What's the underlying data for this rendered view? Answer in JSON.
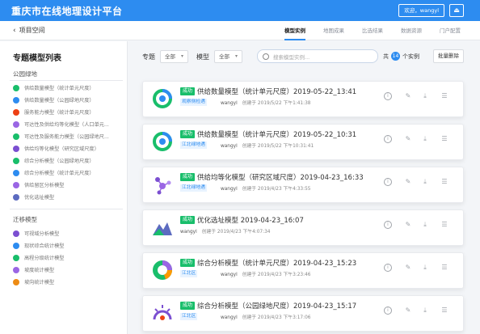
{
  "header": {
    "app_title": "重庆市在线地理设计平台",
    "welcome": "欢迎，wangyl",
    "logout_icon": "logout-icon"
  },
  "subnav": {
    "back_label": "项目空间",
    "tabs": [
      {
        "label": "模型实例",
        "active": true
      },
      {
        "label": "地图成果",
        "active": false
      },
      {
        "label": "比选结果",
        "active": false
      },
      {
        "label": "数据资源",
        "active": false
      },
      {
        "label": "门户配置",
        "active": false
      }
    ]
  },
  "sidebar": {
    "title": "专题模型列表",
    "group1": {
      "label": "公园绿地",
      "items": [
        {
          "label": "供给数量模型（统计单元尺度）",
          "color": "#19be6b"
        },
        {
          "label": "供给数量模型（公园绿地尺度）",
          "color": "#2d8cf0"
        },
        {
          "label": "服务能力模型（统计单元尺度）",
          "color": "#ed4014"
        },
        {
          "label": "可达性及供给均等化模型（人口单元...",
          "color": "#9a66e4"
        },
        {
          "label": "可达性及服务能力模型（公园绿地尺...",
          "color": "#19be6b"
        },
        {
          "label": "供给均等化模型（研究区域尺度）",
          "color": "#7b4fd1"
        },
        {
          "label": "综合分析模型（公园绿地尺度）",
          "color": "#19be6b"
        },
        {
          "label": "综合分析模型（统计单元尺度）",
          "color": "#2d8cf0"
        },
        {
          "label": "供给留区分析模型",
          "color": "#9a66e4"
        },
        {
          "label": "优化选址模型",
          "color": "#5c6bc0"
        }
      ]
    },
    "group2": {
      "label": "迁移模型",
      "items": [
        {
          "label": "可视域分析模型",
          "color": "#7b4fd1"
        },
        {
          "label": "现状综合统计模型",
          "color": "#2d8cf0"
        },
        {
          "label": "高程分级统计模型",
          "color": "#19be6b"
        },
        {
          "label": "坡度统计模型",
          "color": "#9a66e4"
        },
        {
          "label": "坡向统计模型",
          "color": "#ed8b14"
        }
      ]
    }
  },
  "filter": {
    "topic_label": "专题",
    "topic_value": "全部",
    "model_label": "模型",
    "model_value": "全部",
    "search_placeholder": "搜索模型实例...",
    "count_prefix": "共",
    "count_num": "14",
    "count_suffix": "个实例",
    "batch_delete": "批量删除"
  },
  "cards": [
    {
      "status": "成功",
      "title": "供给数量模型（统计单元尺度）2019-05-22_13:41",
      "tag": "观察侧检遇",
      "user": "wangyl",
      "created": "创建于 2019/5/22 下午1:41:38",
      "icon": "ring-chart-icon"
    },
    {
      "status": "成功",
      "title": "供给数量模型（统计单元尺度）2019-05-22_10:31",
      "tag": "江北绿地遇",
      "user": "wangyl",
      "created": "创建于 2019/5/22 下午10:31:41",
      "icon": "ring-chart-icon"
    },
    {
      "status": "成功",
      "title": "供给均等化模型（研究区域尺度）2019-04-23_16:33",
      "tag": "江北绿地遇",
      "user": "wangyl",
      "created": "创建于 2019/4/23 下午4:33:55",
      "icon": "network-icon"
    },
    {
      "status": "成功",
      "title": "优化选址模型 2019-04-23_16:07",
      "tag": "",
      "user": "wangyl",
      "created": "创建于 2019/4/23 下午4:07:34",
      "icon": "mountain-icon"
    },
    {
      "status": "成功",
      "title": "综合分析模型（统计单元尺度）2019-04-23_15:23",
      "tag": "江北区",
      "user": "wangyl",
      "created": "创建于 2019/4/23 下午3:23:46",
      "icon": "donut-icon"
    },
    {
      "status": "成功",
      "title": "综合分析模型（公园绿地尺度）2019-04-23_15:17",
      "tag": "江北区",
      "user": "wangyl",
      "created": "创建于 2019/4/23 下午3:17:06",
      "icon": "sun-gauge-icon"
    }
  ]
}
